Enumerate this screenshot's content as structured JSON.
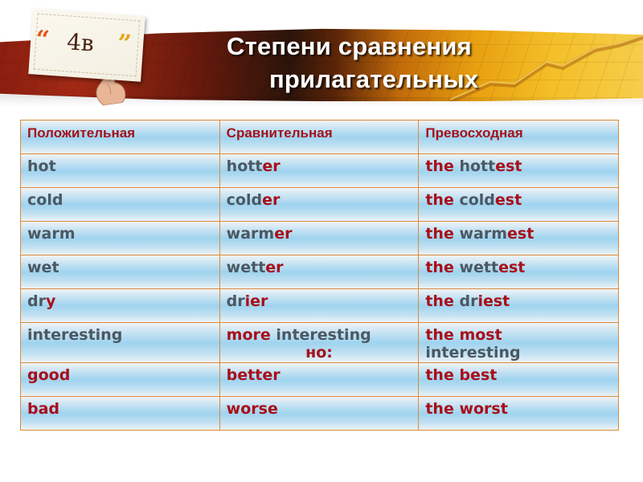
{
  "slide": {
    "title_line1": "Степени сравнения",
    "title_line2": "прилагательных",
    "card_label": "4в",
    "card_quote_open": "“",
    "card_quote_close": "”"
  },
  "colors": {
    "accent_red": "#a80f1a",
    "text_gray": "#4b5862",
    "border_orange": "#d98a3a",
    "cell_blue": "#9fd3ef"
  },
  "table": {
    "headers": [
      "Положительная",
      "Сравнительная",
      "Превосходная"
    ],
    "rows": [
      {
        "positive": [
          {
            "t": "hot",
            "c": "gray"
          }
        ],
        "comparative": [
          {
            "t": "hott",
            "c": "gray"
          },
          {
            "t": "er",
            "c": "red"
          }
        ],
        "superlative": [
          {
            "t": "the ",
            "c": "red"
          },
          {
            "t": "hott",
            "c": "gray"
          },
          {
            "t": "est",
            "c": "red"
          }
        ]
      },
      {
        "positive": [
          {
            "t": "cold",
            "c": "gray"
          }
        ],
        "comparative": [
          {
            "t": "cold",
            "c": "gray"
          },
          {
            "t": "er",
            "c": "red"
          }
        ],
        "superlative": [
          {
            "t": "the ",
            "c": "red"
          },
          {
            "t": "cold",
            "c": "gray"
          },
          {
            "t": "est",
            "c": "red"
          }
        ]
      },
      {
        "positive": [
          {
            "t": "warm",
            "c": "gray"
          }
        ],
        "comparative": [
          {
            "t": "warm",
            "c": "gray"
          },
          {
            "t": "er",
            "c": "red"
          }
        ],
        "superlative": [
          {
            "t": "the ",
            "c": "red"
          },
          {
            "t": "warm",
            "c": "gray"
          },
          {
            "t": "est",
            "c": "red"
          }
        ]
      },
      {
        "positive": [
          {
            "t": "wet",
            "c": "gray"
          }
        ],
        "comparative": [
          {
            "t": "wett",
            "c": "gray"
          },
          {
            "t": "er",
            "c": "red"
          }
        ],
        "superlative": [
          {
            "t": "the ",
            "c": "red"
          },
          {
            "t": "wett",
            "c": "gray"
          },
          {
            "t": "est",
            "c": "red"
          }
        ]
      },
      {
        "positive": [
          {
            "t": "dr",
            "c": "gray"
          },
          {
            "t": "y",
            "c": "red"
          }
        ],
        "comparative": [
          {
            "t": "dr",
            "c": "gray"
          },
          {
            "t": "ier",
            "c": "red"
          }
        ],
        "superlative": [
          {
            "t": "the ",
            "c": "red"
          },
          {
            "t": "dr",
            "c": "gray"
          },
          {
            "t": "iest",
            "c": "red"
          }
        ]
      },
      {
        "tall": true,
        "positive_small": true,
        "positive": [
          {
            "t": "interesting",
            "c": "gray"
          }
        ],
        "comparative": [
          {
            "t": "more ",
            "c": "red"
          },
          {
            "t": "interesting",
            "c": "gray"
          }
        ],
        "comparative_note": "но:",
        "superlative": [
          {
            "t": "the most",
            "c": "red"
          },
          {
            "t": "\n",
            "c": "br"
          },
          {
            "t": "interesting",
            "c": "gray"
          }
        ]
      },
      {
        "positive": [
          {
            "t": "good",
            "c": "red"
          }
        ],
        "comparative": [
          {
            "t": "better",
            "c": "red"
          }
        ],
        "superlative": [
          {
            "t": "the best",
            "c": "red"
          }
        ]
      },
      {
        "positive": [
          {
            "t": "bad",
            "c": "red"
          }
        ],
        "comparative": [
          {
            "t": "worse",
            "c": "red"
          }
        ],
        "superlative": [
          {
            "t": "the worst",
            "c": "red"
          }
        ]
      }
    ]
  }
}
